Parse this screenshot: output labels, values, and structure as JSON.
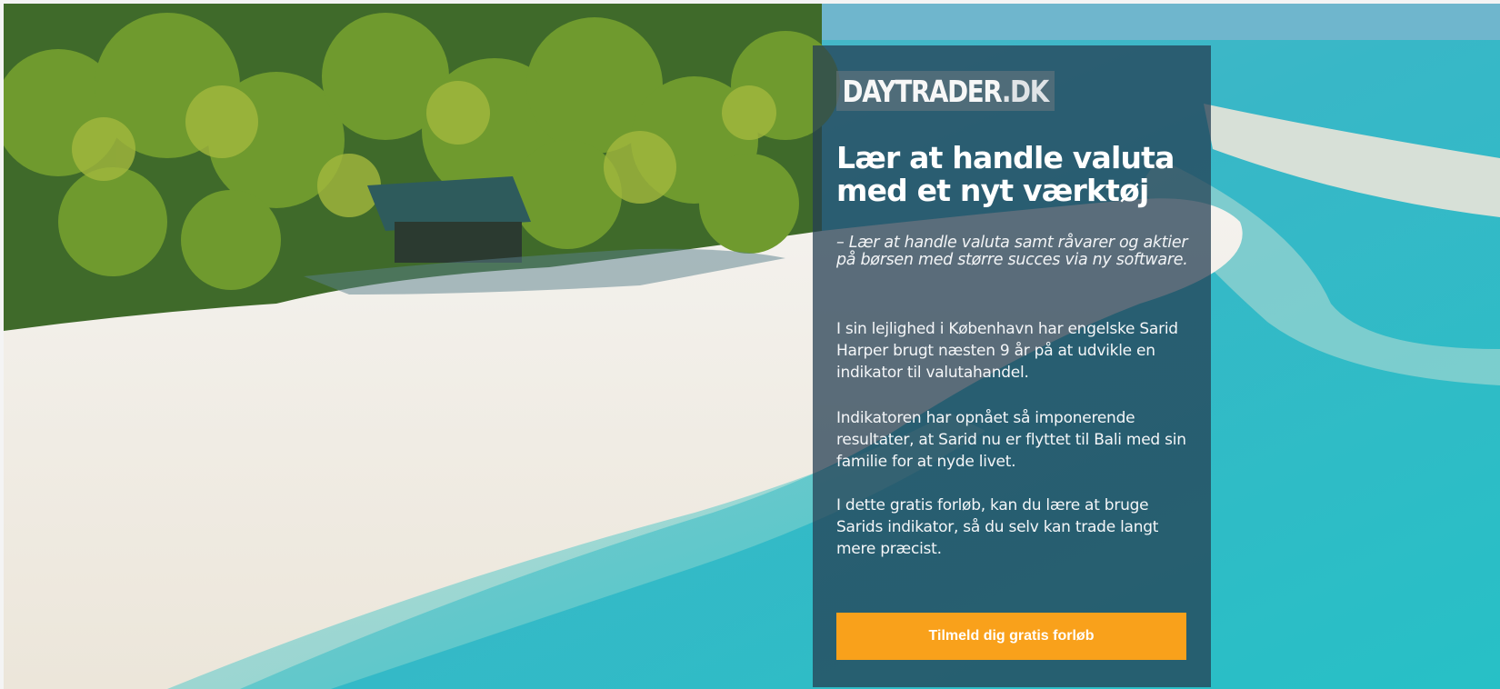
{
  "logo": {
    "brand": "DAYTRADER",
    "tld": ".DK"
  },
  "headline": "Lær at handle valuta med et nyt værktøj",
  "subheadline": "– Lær at handle valuta samt råvarer og aktier på børsen med større succes via ny software.",
  "paragraphs": [
    "I sin lejlighed i København har engelske Sarid Harper brugt næsten 9 år på at udvikle en indikator til valutahandel.",
    "Indikatoren har opnået så imponerende resultater, at Sarid nu er flyttet til Bali med sin familie for at nyde livet.",
    "I dette gratis forløb, kan du lære at bruge Sarids indikator, så du selv kan trade langt mere præcist."
  ],
  "cta": {
    "label": "Tilmeld dig gratis forløb",
    "color": "#f9a11b"
  },
  "colors": {
    "panel": "#243e52",
    "sea": "#2fa9bf",
    "sand": "#f1eee7"
  }
}
